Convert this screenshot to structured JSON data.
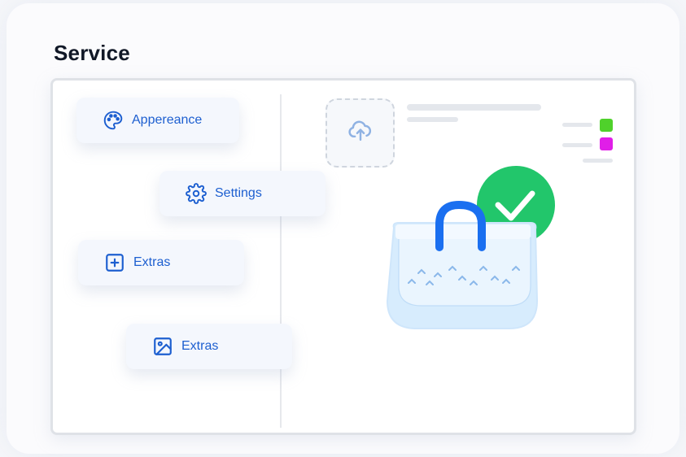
{
  "page": {
    "title": "Service"
  },
  "menu": {
    "items": [
      {
        "label": "Appereance",
        "icon": "palette-icon"
      },
      {
        "label": "Settings",
        "icon": "gear-icon"
      },
      {
        "label": "Extras",
        "icon": "plus-square-icon"
      },
      {
        "label": "Extras",
        "icon": "image-icon"
      }
    ]
  },
  "upload": {
    "icon": "cloud-upload-icon"
  },
  "colors": {
    "accent": "#1d5fd0",
    "swatch_green": "#4fd12b",
    "swatch_magenta": "#e01ee8",
    "check_green": "#22c66b",
    "bag_handle": "#1a6ff0"
  },
  "illustration": {
    "icon": "shopping-bag-check-icon"
  }
}
